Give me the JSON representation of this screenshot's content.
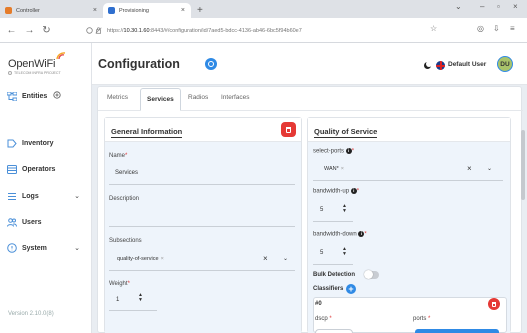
{
  "browser": {
    "tabs": [
      {
        "title": "Controller",
        "active": false
      },
      {
        "title": "Provisioning",
        "active": true
      }
    ],
    "new_tab": "+",
    "url_plain": "https://",
    "url_strong": "10.30.1.60",
    "url_rest": ":8443/#/configuration/id/7aed5-bdcc-4136-ab46-6bc5f94b60e7"
  },
  "sidebar": {
    "logo": "OpenWiFi",
    "logo_sub": "TELECOM INFRA PROJECT",
    "items": [
      {
        "label": "Entities",
        "icon": "entities-icon",
        "has_action": true
      },
      {
        "label": "Inventory",
        "icon": "inventory-icon"
      },
      {
        "label": "Operators",
        "icon": "operators-icon"
      },
      {
        "label": "Logs",
        "icon": "logs-icon",
        "has_chevron": true
      },
      {
        "label": "Users",
        "icon": "users-icon"
      },
      {
        "label": "System",
        "icon": "system-icon",
        "has_chevron": true
      }
    ],
    "version": "Version 2.10.0(8)"
  },
  "header": {
    "title": "Configuration",
    "user": "Default User",
    "avatar_initials": "DU"
  },
  "tabs": [
    "Metrics",
    "Services",
    "Radios",
    "Interfaces"
  ],
  "active_tab": "Services",
  "general": {
    "title": "General Information",
    "name_label": "Name",
    "name_value": "Services",
    "description_label": "Description",
    "description_value": "",
    "subsections_label": "Subsections",
    "subsections_chip": "quality-of-service",
    "weight_label": "Weight",
    "weight_value": "1"
  },
  "qos": {
    "title": "Quality of Service",
    "select_ports_label": "select-ports",
    "select_ports_chip": "WAN*",
    "bandwidth_up_label": "bandwidth-up",
    "bandwidth_up_value": "5",
    "bandwidth_down_label": "bandwidth-down",
    "bandwidth_down_value": "5",
    "bulk_detection_label": "Bulk Detection",
    "bulk_detection_on": false,
    "classifiers_label": "Classifiers",
    "classifier_index": "#0",
    "dscp_label": "dscp",
    "ports_label": "ports"
  },
  "colors": {
    "accent": "#2f8ae5",
    "danger": "#e53935",
    "panel_bg": "#eef4fb"
  }
}
